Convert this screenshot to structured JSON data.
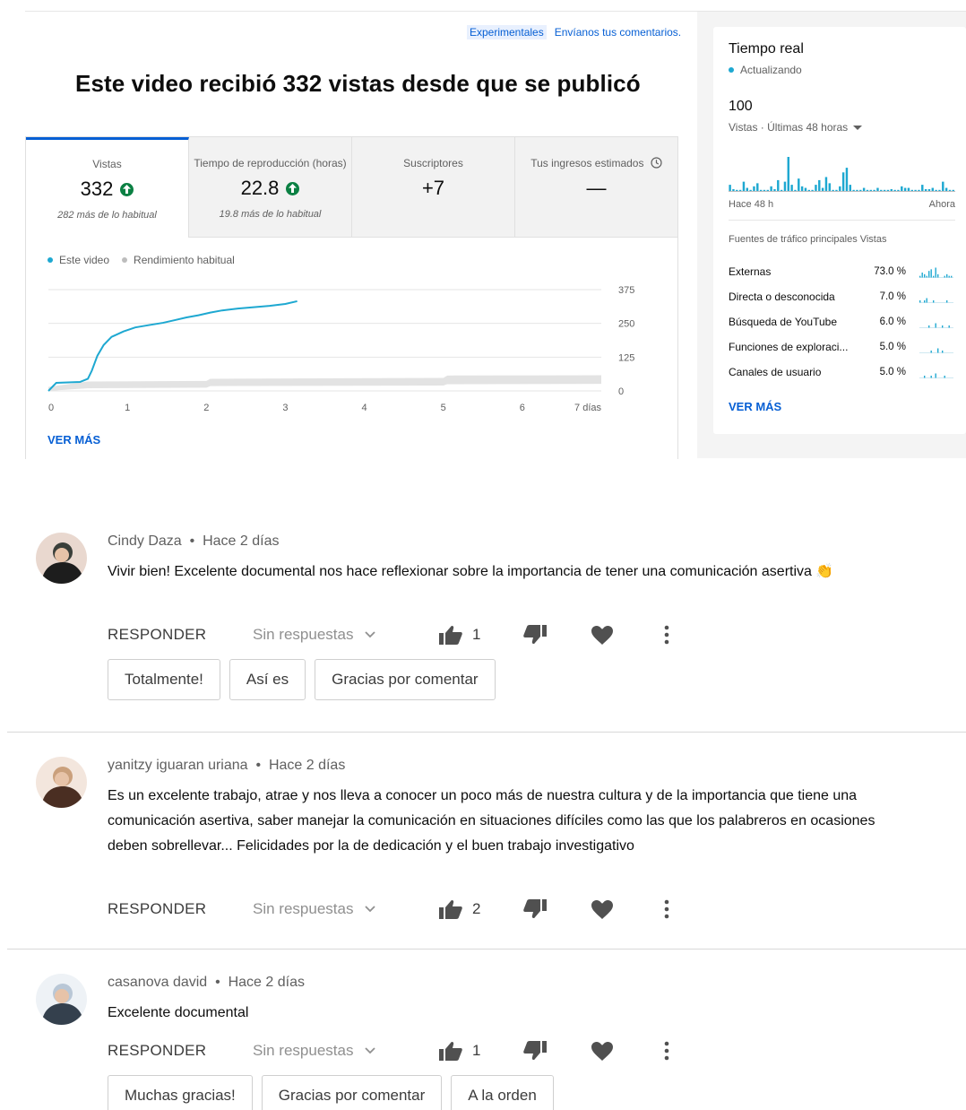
{
  "header": {
    "experimental_label": "Experimentales",
    "feedback_link": "Envíanos tus comentarios.",
    "headline": "Este video recibió 332 vistas desde que se publicó"
  },
  "metrics": [
    {
      "label": "Vistas",
      "value": "332",
      "trend": "up",
      "sub": "282 más de lo habitual",
      "active": true
    },
    {
      "label": "Tiempo de reproducción (horas)",
      "value": "22.8",
      "trend": "up",
      "sub": "19.8 más de lo habitual",
      "active": false
    },
    {
      "label": "Suscriptores",
      "value": "+7",
      "trend": "",
      "sub": "",
      "active": false
    },
    {
      "label": "Tus ingresos estimados",
      "value": "—",
      "trend": "",
      "sub": "",
      "active": false
    }
  ],
  "legend": {
    "this_video": "Este video",
    "typical": "Rendimiento habitual",
    "this_video_color": "#1ea8d1",
    "typical_color": "#bdbdbd"
  },
  "chart_data": {
    "type": "line",
    "x_ticks": [
      "0",
      "1",
      "2",
      "3",
      "4",
      "5",
      "6",
      "7 días"
    ],
    "y_ticks": [
      "0",
      "125",
      "250",
      "375"
    ],
    "xlim": [
      0,
      7
    ],
    "ylim": [
      0,
      375
    ],
    "series": [
      {
        "name": "Este video",
        "x": [
          0,
          0.1,
          0.4,
          0.5,
          0.55,
          0.62,
          0.7,
          0.8,
          0.95,
          1.1,
          1.3,
          1.45,
          1.6,
          1.75,
          1.9,
          2.05,
          2.2,
          2.4,
          2.6,
          2.8,
          3.0,
          3.15
        ],
        "y": [
          0,
          30,
          33,
          45,
          75,
          130,
          170,
          200,
          220,
          235,
          245,
          252,
          262,
          272,
          280,
          290,
          298,
          305,
          310,
          315,
          322,
          332
        ]
      },
      {
        "name": "Rendimiento habitual",
        "band_x": [
          0,
          0.5,
          2.0,
          2.05,
          5.0,
          5.05,
          7.0
        ],
        "low": [
          0,
          10,
          12,
          18,
          20,
          25,
          26
        ],
        "high": [
          15,
          35,
          37,
          45,
          48,
          57,
          58
        ]
      }
    ],
    "ver_mas": "VER MÁS"
  },
  "realtime": {
    "title": "Tiempo real",
    "status": "Actualizando",
    "count": "100",
    "period": "Vistas · Últimas 48 horas",
    "start_label": "Hace 48 h",
    "end_label": "Ahora",
    "bars": [
      4,
      1,
      0,
      0,
      6,
      2,
      0,
      3,
      5,
      0,
      0,
      0,
      3,
      1,
      7,
      0,
      6,
      22,
      4,
      0,
      8,
      3,
      2,
      0,
      0,
      4,
      7,
      2,
      9,
      5,
      0,
      0,
      3,
      12,
      15,
      4,
      0,
      0,
      0,
      2,
      0,
      0,
      0,
      2,
      0,
      0,
      0,
      1,
      0,
      0,
      3,
      2,
      2,
      0,
      0,
      0,
      4,
      1,
      1,
      2,
      0,
      0,
      6,
      2,
      0,
      0
    ],
    "sources_header": "Fuentes de tráfico principales",
    "sources_col": "Vistas",
    "sources": [
      {
        "name": "Externas",
        "pct": "73.0 %",
        "spark": [
          1,
          3,
          2,
          1,
          4,
          5,
          1,
          6,
          2,
          0,
          0,
          1,
          2,
          1,
          1
        ]
      },
      {
        "name": "Directa o desconocida",
        "pct": "7.0 %",
        "spark": [
          1,
          0,
          1,
          2,
          0,
          0,
          1,
          0,
          0,
          0,
          0,
          0,
          1,
          0,
          0
        ]
      },
      {
        "name": "Búsqueda de YouTube",
        "pct": "6.0 %",
        "spark": [
          0,
          0,
          0,
          0,
          1,
          0,
          0,
          2,
          0,
          0,
          1,
          0,
          0,
          1,
          0
        ]
      },
      {
        "name": "Funciones de exploración",
        "name_display": "Funciones de exploraci...",
        "pct": "5.0 %",
        "spark": [
          0,
          0,
          0,
          0,
          0,
          1,
          0,
          0,
          2,
          0,
          1,
          0,
          0,
          0,
          0
        ]
      },
      {
        "name": "Canales de usuario",
        "pct": "5.0 %",
        "spark": [
          0,
          0,
          1,
          0,
          0,
          1,
          0,
          2,
          0,
          0,
          0,
          1,
          0,
          0,
          0
        ]
      }
    ],
    "ver_mas": "VER MÁS",
    "accent": "#1ea8d1"
  },
  "comments": [
    {
      "author": "Cindy Daza",
      "time": "Hace 2 días",
      "text": "Vivir bien! Excelente documental nos hace reflexionar sobre la importancia de tener una comunicación asertiva 👏",
      "reply": "RESPONDER",
      "replies": "Sin respuestas",
      "likes": "1",
      "suggestions": [
        "Totalmente!",
        "Así es",
        "Gracias por comentar"
      ]
    },
    {
      "author": "yanitzy iguaran uriana",
      "time": "Hace 2 días",
      "text": "Es un excelente trabajo, atrae y nos lleva a conocer un poco más de nuestra cultura y de la importancia que tiene una comunicación asertiva, saber manejar la comunicación en situaciones difíciles como las que los palabreros en ocasiones deben sobrellevar... Felicidades por la de dedicación y el buen trabajo investigativo",
      "reply": "RESPONDER",
      "replies": "Sin respuestas",
      "likes": "2",
      "suggestions": []
    },
    {
      "author": "casanova david",
      "time": "Hace 2 días",
      "text": "Excelente documental",
      "reply": "RESPONDER",
      "replies": "Sin respuestas",
      "likes": "1",
      "suggestions": [
        "Muchas gracias!",
        "Gracias por comentar",
        "A la orden"
      ]
    }
  ]
}
